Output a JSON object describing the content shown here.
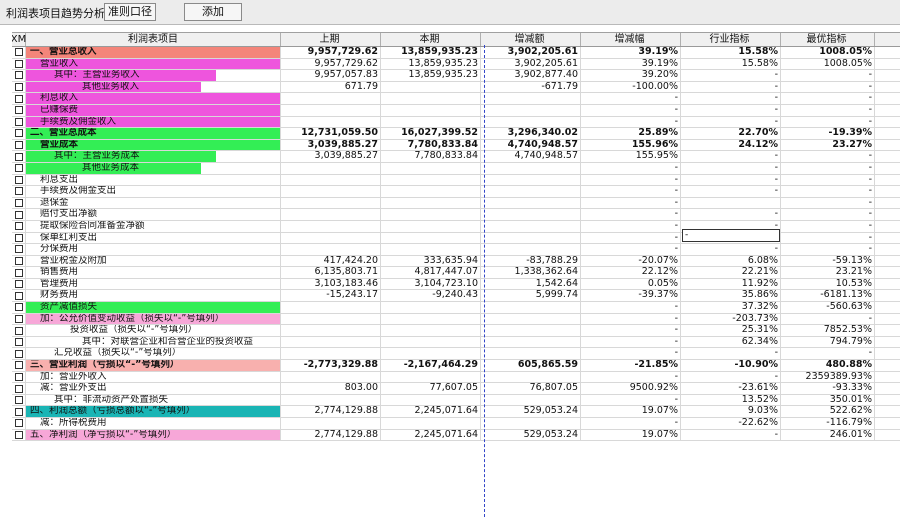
{
  "toolbar": {
    "title": "利润表项目趋势分析",
    "btn_standard": "准则口径",
    "btn_add": "添加"
  },
  "colors": {
    "salmon": "#f4857a",
    "magenta": "#ee55dd",
    "green": "#33ee55",
    "pink": "#f7a7d8",
    "teal": "#1ab5b5",
    "light_salmon": "#f8b0ae"
  },
  "columns": [
    "XM",
    "利润表项目",
    "上期",
    "本期",
    "增减额",
    "增减幅",
    "行业指标",
    "最优指标"
  ],
  "edit_value": "-",
  "rows": [
    {
      "label": "一、营业总收入",
      "indent": 0,
      "bg": "#f4857a",
      "span": 1,
      "bold": true,
      "v": [
        "9,957,729.62",
        "13,859,935.23",
        "3,902,205.61",
        "39.19%",
        "15.58%",
        "1008.05%"
      ]
    },
    {
      "label": "营业收入",
      "indent": 1,
      "bg": "#ee55dd",
      "span": 1,
      "bold": false,
      "v": [
        "9,957,729.62",
        "13,859,935.23",
        "3,902,205.61",
        "39.19%",
        "15.58%",
        "1008.05%"
      ]
    },
    {
      "label": "其中：主营业务收入",
      "indent": 2,
      "bg": "#ee55dd",
      "span": 1,
      "bold": false,
      "v": [
        "9,957,057.83",
        "13,859,935.23",
        "3,902,877.40",
        "39.20%",
        "-",
        "-"
      ]
    },
    {
      "label": "其他业务收入",
      "indent": 4,
      "bg": "#ee55dd",
      "span": 1,
      "bold": false,
      "v": [
        "671.79",
        "",
        "-671.79",
        "-100.00%",
        "-",
        "-"
      ]
    },
    {
      "label": "利息收入",
      "indent": 1,
      "bg": "#ee55dd",
      "span": 1,
      "bold": false,
      "v": [
        "",
        "",
        "",
        "-",
        "-",
        "-"
      ]
    },
    {
      "label": "已赚保费",
      "indent": 1,
      "bg": "#ee55dd",
      "span": 1,
      "bold": false,
      "v": [
        "",
        "",
        "",
        "-",
        "-",
        "-"
      ]
    },
    {
      "label": "手续费及佣金收入",
      "indent": 1,
      "bg": "#ee55dd",
      "span": 1,
      "bold": false,
      "v": [
        "",
        "",
        "",
        "-",
        "-",
        "-"
      ]
    },
    {
      "label": "二、营业总成本",
      "indent": 0,
      "bg": "#33ee55",
      "span": 1,
      "bold": true,
      "v": [
        "12,731,059.50",
        "16,027,399.52",
        "3,296,340.02",
        "25.89%",
        "22.70%",
        "-19.39%"
      ]
    },
    {
      "label": "营业成本",
      "indent": 1,
      "bg": "#33ee55",
      "span": 1,
      "bold": true,
      "v": [
        "3,039,885.27",
        "7,780,833.84",
        "4,740,948.57",
        "155.96%",
        "24.12%",
        "23.27%"
      ]
    },
    {
      "label": "其中：主营业务成本",
      "indent": 2,
      "bg": "#33ee55",
      "span": 1,
      "bold": false,
      "v": [
        "3,039,885.27",
        "7,780,833.84",
        "4,740,948.57",
        "155.95%",
        "-",
        "-"
      ]
    },
    {
      "label": "其他业务成本",
      "indent": 4,
      "bg": "#33ee55",
      "span": 1,
      "bold": false,
      "v": [
        "",
        "",
        "",
        "-",
        "-",
        "-"
      ]
    },
    {
      "label": "利息支出",
      "indent": 1,
      "bg": "",
      "span": 1,
      "bold": false,
      "v": [
        "",
        "",
        "",
        "-",
        "-",
        "-"
      ]
    },
    {
      "label": "手续费及佣金支出",
      "indent": 1,
      "bg": "",
      "span": 1,
      "bold": false,
      "v": [
        "",
        "",
        "",
        "-",
        "-",
        "-"
      ]
    },
    {
      "label": "退保金",
      "indent": 1,
      "bg": "",
      "span": 1,
      "bold": false,
      "v": [
        "",
        "",
        "",
        "-",
        "",
        "-"
      ]
    },
    {
      "label": "赔付支出净额",
      "indent": 1,
      "bg": "",
      "span": 1,
      "bold": false,
      "v": [
        "",
        "",
        "",
        "-",
        "-",
        "-"
      ]
    },
    {
      "label": "提取保险合同准备金净额",
      "indent": 1,
      "bg": "",
      "span": 1,
      "bold": false,
      "v": [
        "",
        "",
        "",
        "-",
        "-",
        "-"
      ]
    },
    {
      "label": "保单红利支出",
      "indent": 1,
      "bg": "",
      "span": 1,
      "bold": false,
      "v": [
        "",
        "",
        "",
        "-",
        "-",
        "-"
      ]
    },
    {
      "label": "分保费用",
      "indent": 1,
      "bg": "",
      "span": 1,
      "bold": false,
      "v": [
        "",
        "",
        "",
        "-",
        "-",
        "-"
      ]
    },
    {
      "label": "营业税金及附加",
      "indent": 1,
      "bg": "",
      "span": 1,
      "bold": false,
      "v": [
        "417,424.20",
        "333,635.94",
        "-83,788.29",
        "-20.07%",
        "6.08%",
        "-59.13%"
      ]
    },
    {
      "label": "销售费用",
      "indent": 1,
      "bg": "",
      "span": 1,
      "bold": false,
      "v": [
        "6,135,803.71",
        "4,817,447.07",
        "1,338,362.64",
        "22.12%",
        "22.21%",
        "23.21%"
      ]
    },
    {
      "label": "管理费用",
      "indent": 1,
      "bg": "",
      "span": 1,
      "bold": false,
      "v": [
        "3,103,183.46",
        "3,104,723.10",
        "1,542.64",
        "0.05%",
        "11.92%",
        "10.53%"
      ]
    },
    {
      "label": "财务费用",
      "indent": 1,
      "bg": "",
      "span": 1,
      "bold": false,
      "v": [
        "-15,243.17",
        "-9,240.43",
        "5,999.74",
        "-39.37%",
        "35.86%",
        "-6181.13%"
      ]
    },
    {
      "label": "资产减值损失",
      "indent": 1,
      "bg": "#33ee55",
      "span": 1,
      "bold": false,
      "v": [
        "",
        "",
        "",
        "-",
        "37.32%",
        "-560.63%"
      ]
    },
    {
      "label": "加：公允价值变动收益（损失以“-”号填列）",
      "indent": 1,
      "bg": "#f7a7d8",
      "span": 1,
      "bold": false,
      "v": [
        "",
        "",
        "",
        "-",
        "-203.73%",
        "-"
      ]
    },
    {
      "label": "投资收益（损失以“-”号填列）",
      "indent": 3,
      "bg": "",
      "span": 1,
      "bold": false,
      "v": [
        "",
        "",
        "",
        "-",
        "25.31%",
        "7852.53%"
      ]
    },
    {
      "label": "其中：对联营企业和合营企业的投资收益",
      "indent": 4,
      "bg": "",
      "span": 1,
      "bold": false,
      "v": [
        "",
        "",
        "",
        "-",
        "62.34%",
        "794.79%"
      ]
    },
    {
      "label": "汇兑收益（损失以“-”号填列）",
      "indent": 2,
      "bg": "",
      "span": 1,
      "bold": false,
      "v": [
        "",
        "",
        "",
        "-",
        "-",
        "-"
      ]
    },
    {
      "label": "三、营业利润（亏损以“-”号填列）",
      "indent": 0,
      "bg": "#f8b0ae",
      "span": 1,
      "bold": true,
      "v": [
        "-2,773,329.88",
        "-2,167,464.29",
        "605,865.59",
        "-21.85%",
        "-10.90%",
        "480.88%"
      ]
    },
    {
      "label": "加：营业外收入",
      "indent": 1,
      "bg": "",
      "span": 1,
      "bold": false,
      "v": [
        "",
        "",
        "",
        "-",
        "-",
        "2359389.93%"
      ]
    },
    {
      "label": "减：营业外支出",
      "indent": 1,
      "bg": "",
      "span": 1,
      "bold": false,
      "v": [
        "803.00",
        "77,607.05",
        "76,807.05",
        "9500.92%",
        "-23.61%",
        "-93.33%"
      ]
    },
    {
      "label": "其中：非流动资产处置损失",
      "indent": 2,
      "bg": "",
      "span": 1,
      "bold": false,
      "v": [
        "",
        "",
        "",
        "-",
        "13.52%",
        "350.01%"
      ]
    },
    {
      "label": "四、利润总额（亏损总额以“-”号填列）",
      "indent": 0,
      "bg": "#1ab5b5",
      "span": 1,
      "bold": false,
      "v": [
        "2,774,129.88",
        "2,245,071.64",
        "529,053.24",
        "19.07%",
        "9.03%",
        "522.62%"
      ]
    },
    {
      "label": "减：所得税费用",
      "indent": 1,
      "bg": "",
      "span": 1,
      "bold": false,
      "v": [
        "",
        "",
        "",
        "-",
        "-22.62%",
        "-116.79%"
      ]
    },
    {
      "label": "五、净利润（净亏损以“-”号填列）",
      "indent": 0,
      "bg": "#f7a7d8",
      "span": 1,
      "bold": false,
      "v": [
        "2,774,129.88",
        "2,245,071.64",
        "529,053.24",
        "19.07%",
        "-",
        "246.01%"
      ]
    }
  ]
}
